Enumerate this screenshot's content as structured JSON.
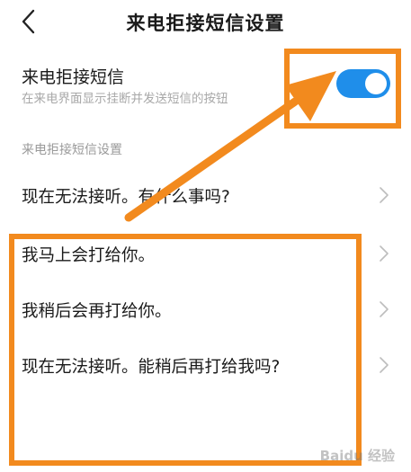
{
  "header": {
    "title": "来电拒接短信设置",
    "back_icon": "chevron-left-icon"
  },
  "main_setting": {
    "label": "来电拒接短信",
    "description": "在来电界面显示挂断并发送短信的按钮",
    "enabled": true,
    "toggle_color": "#1f8eea"
  },
  "section": {
    "label": "来电拒接短信设置"
  },
  "messages": [
    {
      "text": "现在无法接听。有什么事吗?"
    },
    {
      "text": "我马上会打给你。"
    },
    {
      "text": "我稍后会再打给你。"
    },
    {
      "text": "现在无法接听。能稍后再打给我吗?"
    }
  ],
  "annotation": {
    "color": "#f28a1e"
  },
  "watermark": {
    "text": "Baidu 经验"
  }
}
